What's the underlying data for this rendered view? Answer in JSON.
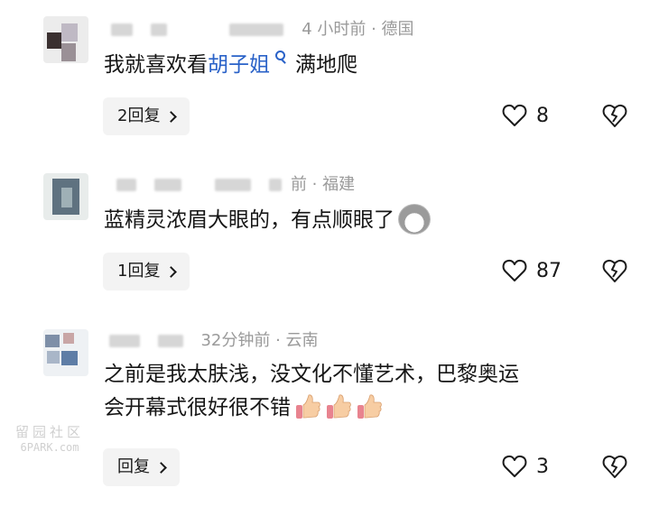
{
  "comments": [
    {
      "meta_location": "4 小时前 · 德国",
      "text_before": "我就喜欢看",
      "topic": "胡子姐",
      "text_after": "满地爬",
      "reply_label": "2回复",
      "likes": "8"
    },
    {
      "meta_location": "前 · 福建",
      "text": "蓝精灵浓眉大眼的，有点顺眼了",
      "reply_label": "1回复",
      "likes": "87"
    },
    {
      "meta_location": "32分钟前 · 云南",
      "line1": "之前是我太肤浅，没文化不懂艺术，巴黎奥运",
      "line2": "会开幕式很好很不错",
      "reply_label": "回复",
      "likes": "3"
    }
  ],
  "watermark": {
    "top": "留园社区",
    "bottom": "6PARK.com"
  },
  "colors": {
    "topic": "#2a62c8",
    "reply_bg": "#f3f3f3",
    "meta": "#9a9a9a"
  },
  "icons": [
    "search-icon",
    "chevron-right-icon",
    "heart-outline-icon",
    "broken-heart-icon",
    "dog-emoji-icon",
    "thumbs-up-emoji-icon"
  ]
}
